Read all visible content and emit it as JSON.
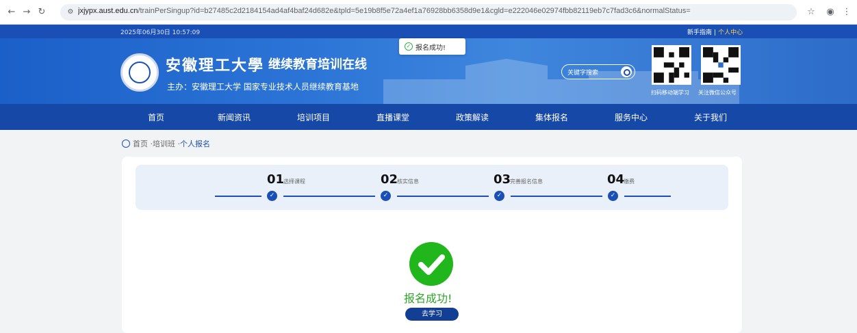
{
  "browser": {
    "url_domain": "jxjypx.aust.edu.cn",
    "url_path": "/trainPerSingup?id=b27485c2d2184154ad4af4baf24d682e&tpld=5e19b8f5e72a4ef1a76928bb6358d9e1&cgld=e222046e02974fbb82119eb7c7fad3c6&normalStatus="
  },
  "topbar": {
    "datetime": "2025年06月30日 10:57:09",
    "guide_link": "新手指南",
    "separator": "|",
    "personal_center_link": "个人中心"
  },
  "header": {
    "university_name": "安徽理工大學",
    "platform_name": "继续教育培训在线",
    "sponsor": "主办：安徽理工大学  国家专业技术人员继续教育基地",
    "search_placeholder": "关键字搜索",
    "qr_mobile_caption": "扫码移动端学习",
    "qr_wechat_caption": "关注微信公众号"
  },
  "toast": {
    "message": "报名成功!"
  },
  "nav": {
    "items": [
      "首页",
      "新闻资讯",
      "培训项目",
      "直播课堂",
      "政策解读",
      "集体报名",
      "服务中心",
      "关于我们"
    ]
  },
  "breadcrumb": {
    "home": "首页",
    "sep1": "·",
    "level2": "培训班",
    "sep2": "·",
    "current": "个人报名"
  },
  "steps": [
    {
      "num": "01",
      "label": "选择课程"
    },
    {
      "num": "02",
      "label": "核实信息"
    },
    {
      "num": "03",
      "label": "完善报名信息"
    },
    {
      "num": "04",
      "label": "缴费"
    }
  ],
  "result": {
    "message": "报名成功!",
    "button_label": "去学习"
  },
  "colors": {
    "primary": "#1a4fb5",
    "nav": "#1648a8",
    "success": "#20b61c",
    "highlight": "#ffd24a"
  }
}
